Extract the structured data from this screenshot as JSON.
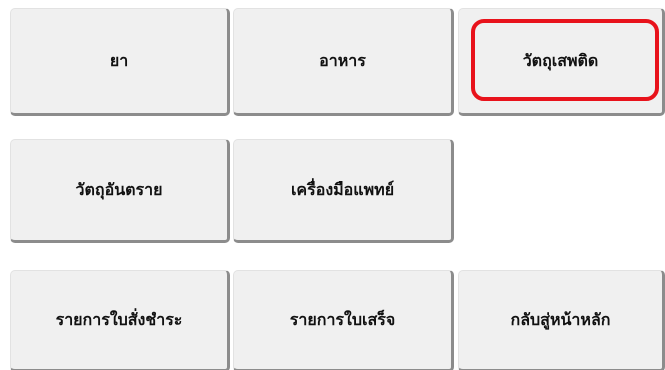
{
  "menu": {
    "row1": {
      "drug_label": "ยา",
      "food_label": "อาหาร",
      "narcotics_label": "วัตถุเสพติด"
    },
    "row2": {
      "hazardous_label": "วัตถุอันตราย",
      "medical_device_label": "เครื่องมือแพทย์"
    },
    "row3": {
      "payment_list_label": "รายการใบสั่งชำระ",
      "receipt_list_label": "รายการใบเสร็จ",
      "home_label": "กลับสู่หน้าหลัก"
    }
  },
  "colors": {
    "tile_background": "#f0f0f0",
    "tile_shadow": "#8c8c8c",
    "highlight": "#e8121b",
    "text": "#111111"
  }
}
